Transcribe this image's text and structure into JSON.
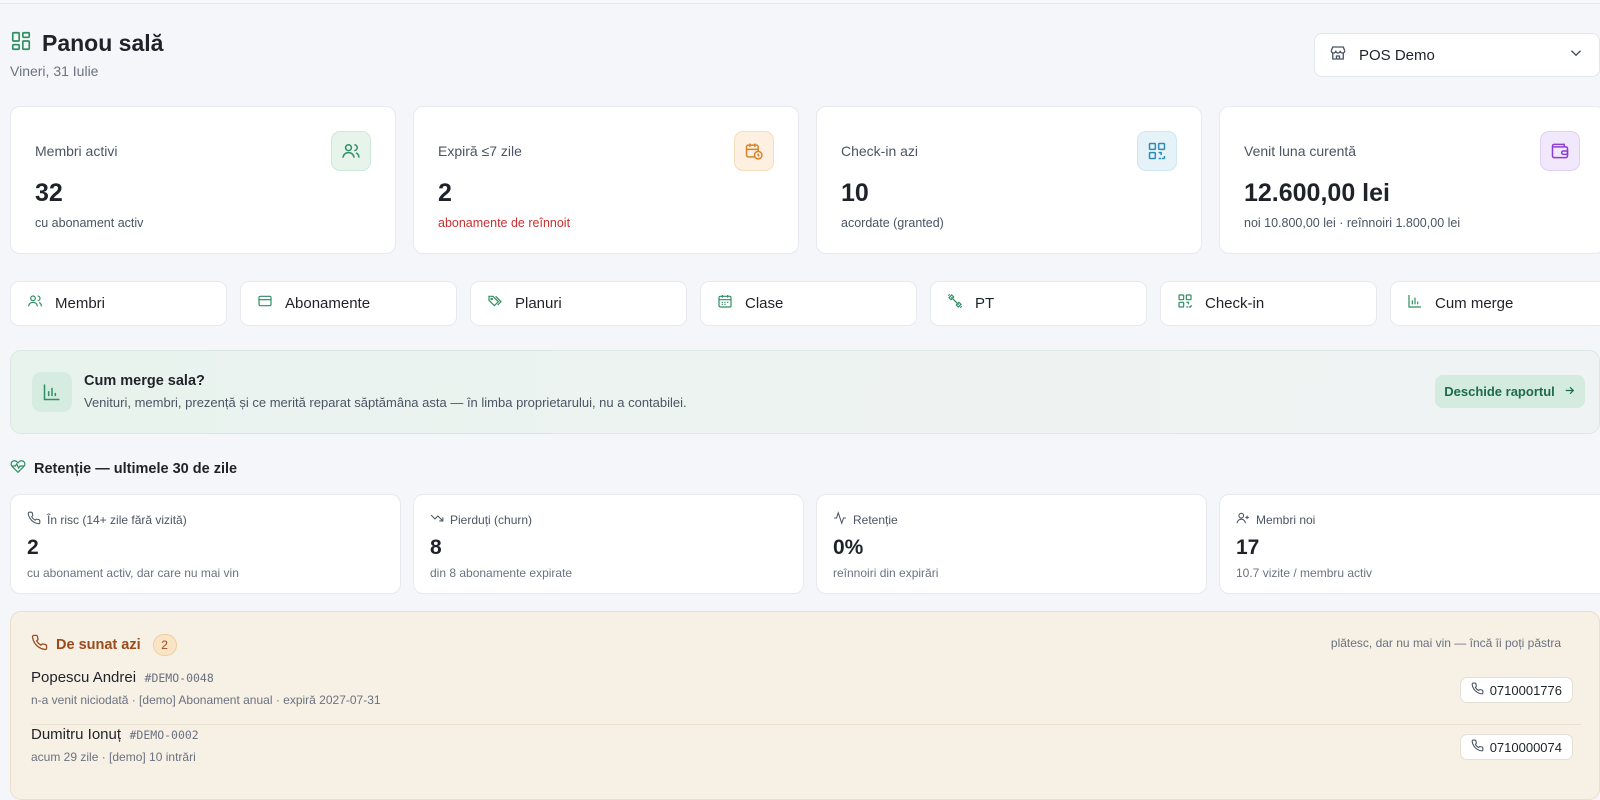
{
  "header": {
    "title": "Panou sală",
    "date": "Vineri, 31 Iulie"
  },
  "store_select": {
    "value": "POS Demo"
  },
  "stats": [
    {
      "label": "Membri activi",
      "value": "32",
      "sub": "cu abonament activ",
      "icon": "users-icon",
      "accent": "#2f8f62"
    },
    {
      "label": "Expiră ≤7 zile",
      "value": "2",
      "sub": "abonamente de reînnoit",
      "icon": "calendar-clock-icon",
      "accent": "#d9822b"
    },
    {
      "label": "Check-in azi",
      "value": "10",
      "sub": "acordate (granted)",
      "icon": "qr-code-icon",
      "accent": "#2e8bb5"
    },
    {
      "label": "Venit luna curentă",
      "value": "12.600,00 lei",
      "sub": "noi 10.800,00 lei · reînnoiri 1.800,00 lei",
      "icon": "wallet-icon",
      "accent": "#8b3fd1"
    }
  ],
  "nav": [
    {
      "label": "Membri",
      "icon": "users-icon"
    },
    {
      "label": "Abonamente",
      "icon": "card-icon"
    },
    {
      "label": "Planuri",
      "icon": "tags-icon"
    },
    {
      "label": "Clase",
      "icon": "calendar-icon"
    },
    {
      "label": "PT",
      "icon": "dumbbell-icon"
    },
    {
      "label": "Check-in",
      "icon": "qr-code-icon"
    },
    {
      "label": "Cum merge",
      "icon": "bar-chart-icon"
    }
  ],
  "banner": {
    "title": "Cum merge sala?",
    "text": "Venituri, membri, prezență și ce merită reparat săptămâna asta — în limba proprietarului, nu a contabilei.",
    "button": "Deschide raportul"
  },
  "retention": {
    "title": "Retenție — ultimele 30 de zile",
    "cards": [
      {
        "label": "În risc (14+ zile fără vizită)",
        "value": "2",
        "sub": "cu abonament activ, dar care nu mai vin",
        "icon": "phone-icon"
      },
      {
        "label": "Pierduți (churn)",
        "value": "8",
        "sub": "din 8 abonamente expirate",
        "icon": "trending-down-icon"
      },
      {
        "label": "Retenție",
        "value": "0%",
        "sub": "reînnoiri din expirări",
        "icon": "activity-icon"
      },
      {
        "label": "Membri noi",
        "value": "17",
        "sub": "10.7 vizite / membru activ",
        "icon": "user-plus-icon"
      }
    ]
  },
  "calls": {
    "title": "De sunat azi",
    "count": "2",
    "hint": "plătesc, dar nu mai vin — încă îi poți păstra",
    "rows": [
      {
        "name": "Popescu Andrei",
        "code": "#DEMO-0048",
        "meta": "n-a venit niciodată · [demo] Abonament anual · expiră 2027-07-31",
        "phone": "0710001776"
      },
      {
        "name": "Dumitru Ionuț",
        "code": "#DEMO-0002",
        "meta": "acum 29 zile · [demo] 10 intrări",
        "phone": "0710000074"
      }
    ]
  },
  "colors": {
    "primary_green": "#2f8f62",
    "danger_red": "#c8312f",
    "call_brown": "#9a4a1d"
  }
}
